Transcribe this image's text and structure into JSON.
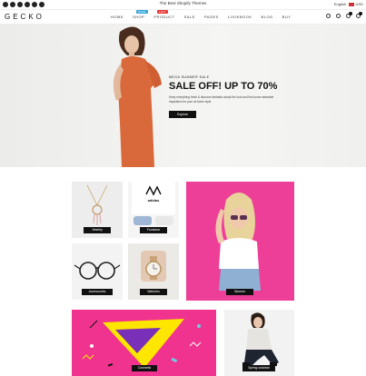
{
  "topbar": {
    "message": "The Best Shopify Themes",
    "language": "English",
    "currency": "USD",
    "social_icons": [
      "facebook-icon",
      "twitter-icon",
      "instagram-icon",
      "pinterest-icon",
      "google-plus-icon",
      "tumblr-icon"
    ]
  },
  "header": {
    "logo": "GECKO",
    "nav": [
      {
        "label": "HOME",
        "badge": ""
      },
      {
        "label": "SHOP",
        "badge": "NEW"
      },
      {
        "label": "PRODUCT",
        "badge": "HOT"
      },
      {
        "label": "SALE",
        "badge": ""
      },
      {
        "label": "PAGES",
        "badge": ""
      },
      {
        "label": "LOOKBOOK",
        "badge": ""
      },
      {
        "label": "BLOG",
        "badge": ""
      },
      {
        "label": "BUY",
        "badge": ""
      }
    ]
  },
  "hero": {
    "kicker": "MEGA SUMMER SALE",
    "headline": "SALE OFF! UP TO 70%",
    "body": "Keep everything fresh & discover fantastic adopt the look and find some wearable inspiration for your at-home style.",
    "cta": "Explore"
  },
  "categories": [
    {
      "label": "Jewelry"
    },
    {
      "label": "Footwear"
    },
    {
      "label": "Women"
    },
    {
      "label": "Accessories"
    },
    {
      "label": "Watches"
    },
    {
      "label": "Cosmetic"
    },
    {
      "label": "Spring outwear"
    }
  ],
  "colors": {
    "accent_new": "#3aa7d9",
    "accent_hot": "#e53935",
    "pink": "#f0338e"
  }
}
